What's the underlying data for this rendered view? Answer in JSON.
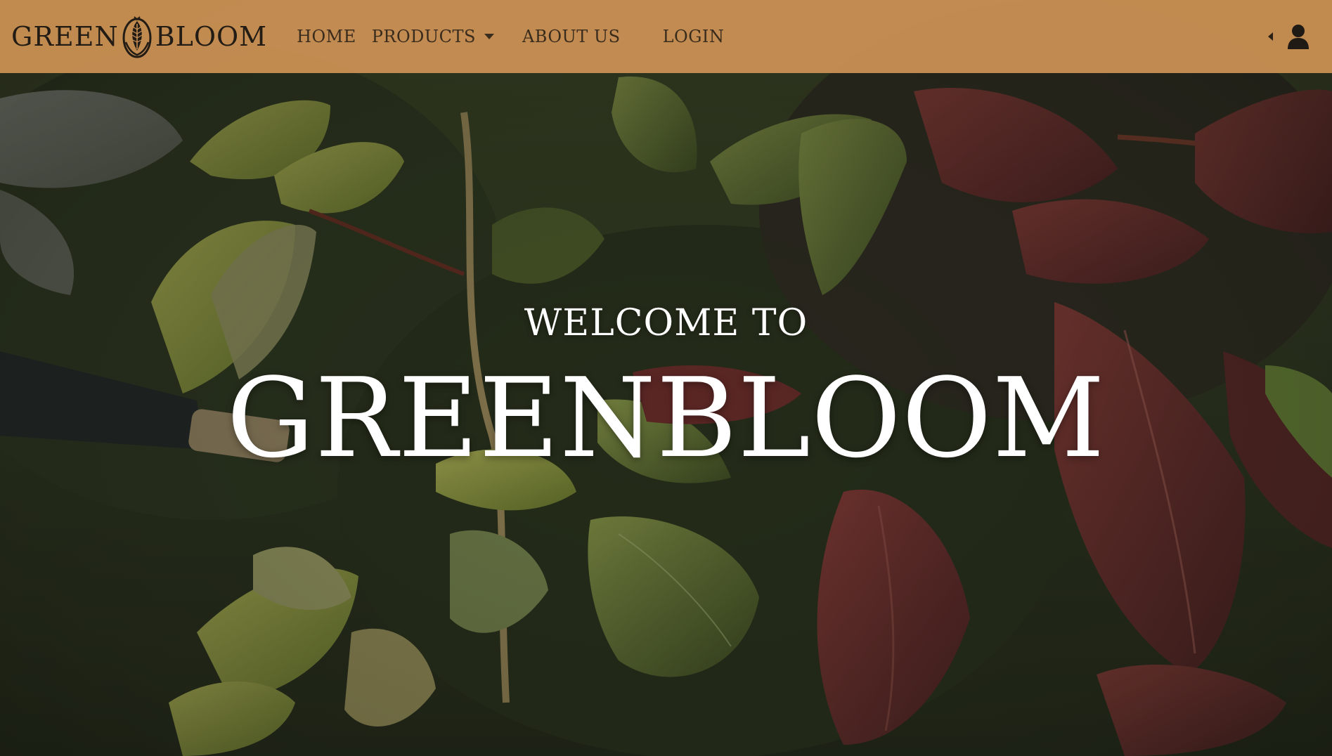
{
  "brand": {
    "left_word": "GREEN",
    "right_word": "BLOOM",
    "mark_icon": "lotus-leaf-emblem-icon"
  },
  "nav": {
    "home": "HOME",
    "products": "PRODUCTS",
    "about": "ABOUT US",
    "login": "LOGIN"
  },
  "icons": {
    "products_dropdown": "caret-down-icon",
    "collapse_toggle": "caret-left-icon",
    "account": "user-icon"
  },
  "hero": {
    "pre_title": "WELCOME TO",
    "title": "GREENBLOOM",
    "background": "wet-vine-leaves-watering-photo"
  },
  "colors": {
    "navbar_bg": "#ce9255",
    "nav_text": "#3a2c1c",
    "hero_text": "#ffffff"
  }
}
